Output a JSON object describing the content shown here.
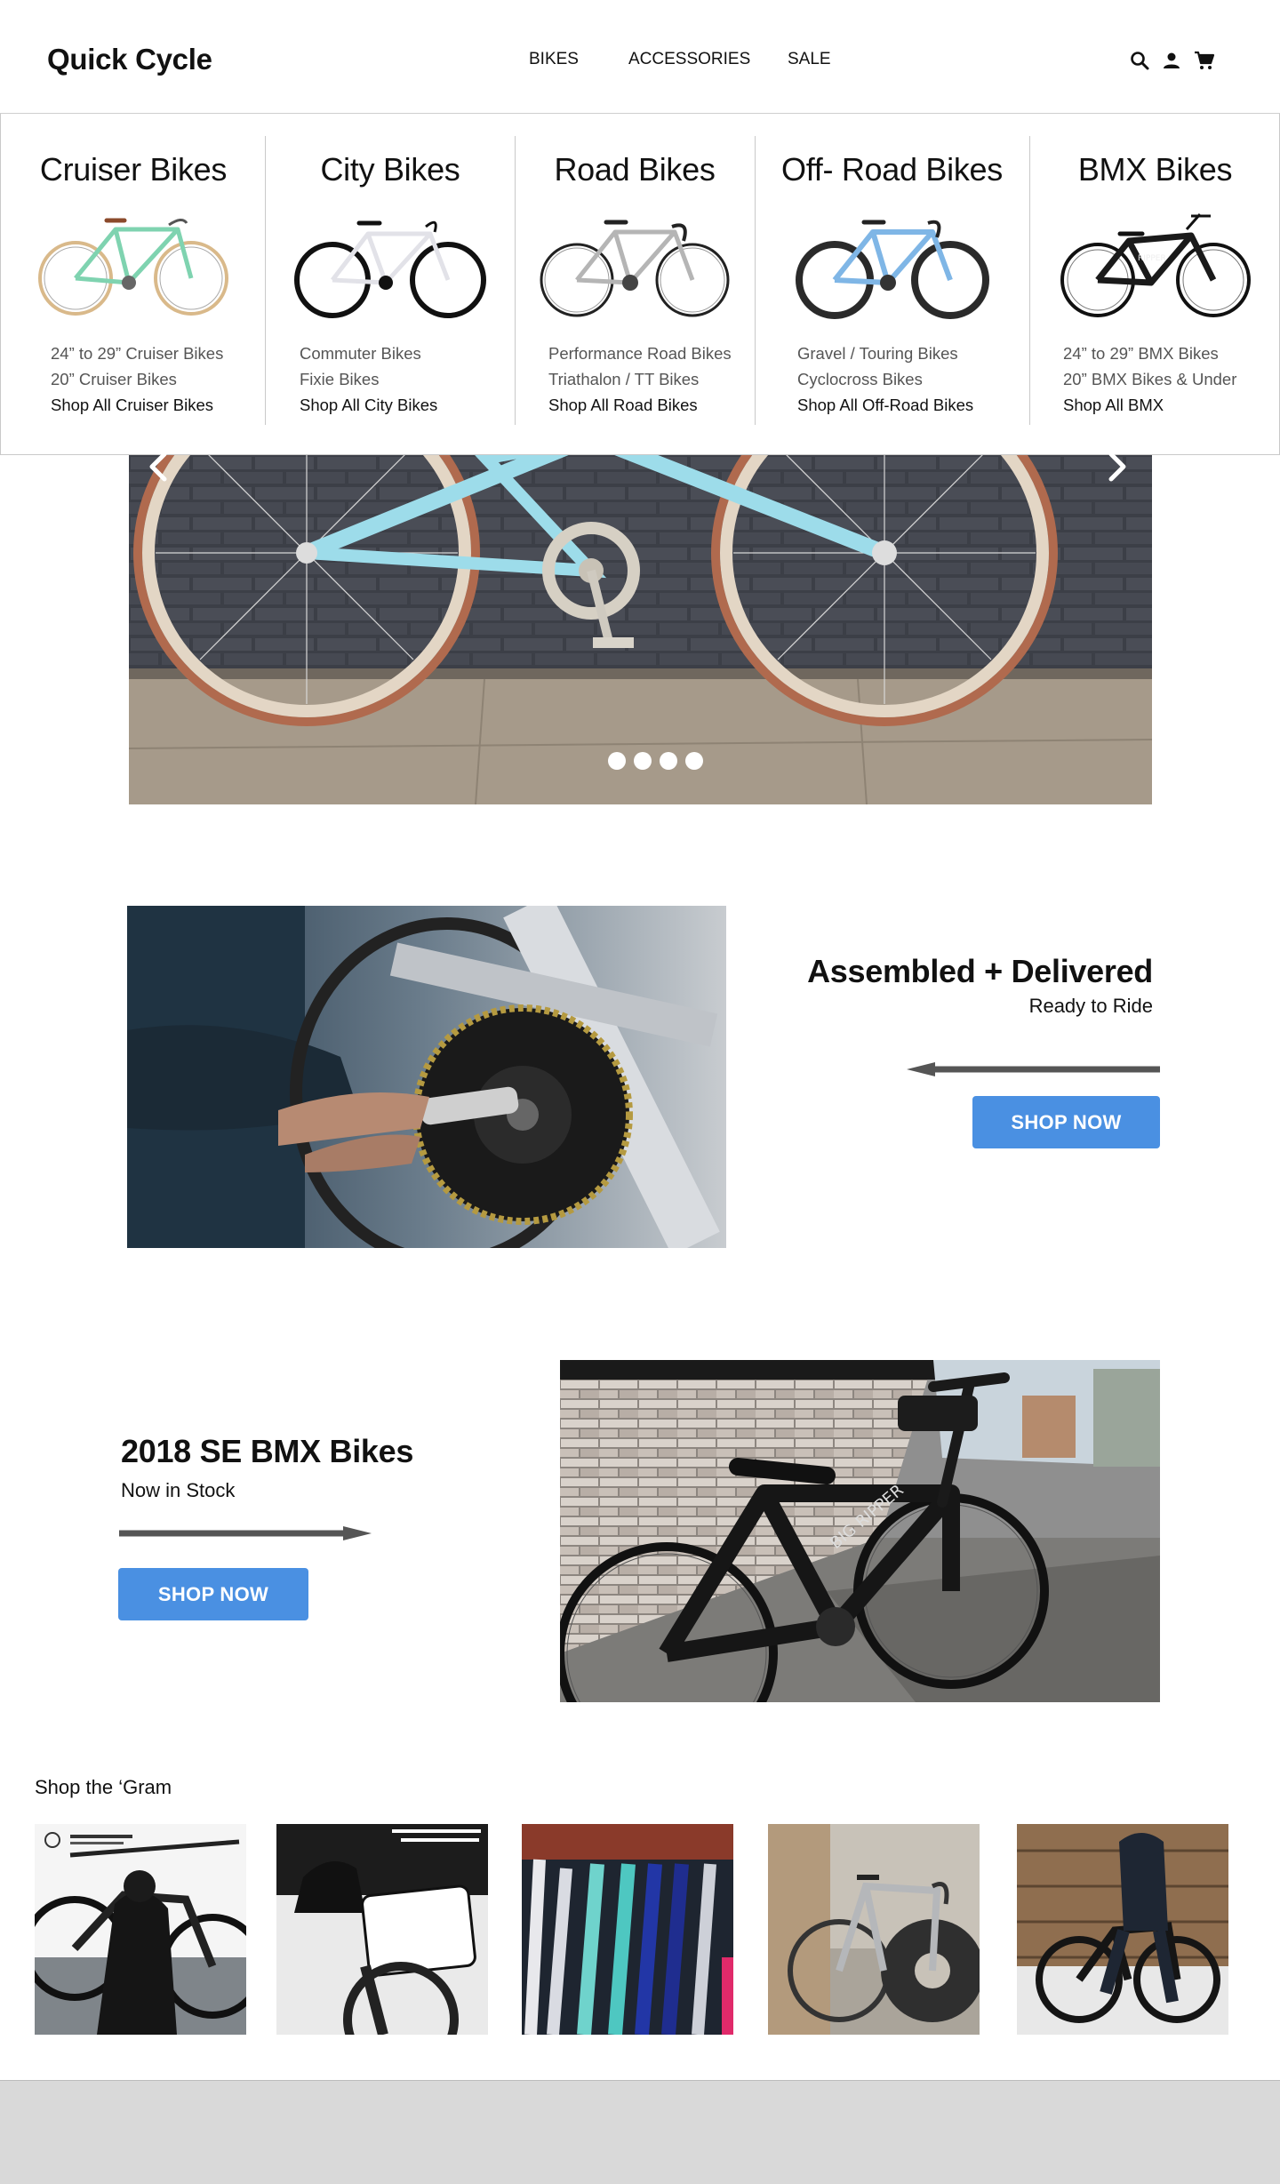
{
  "brand": {
    "logo": "Quick Cycle"
  },
  "nav": {
    "items": [
      "BIKES",
      "ACCESSORIES",
      "SALE"
    ],
    "icons": [
      "search-icon",
      "user-icon",
      "cart-icon"
    ]
  },
  "mega_menu": {
    "columns": [
      {
        "title": "Cruiser Bikes",
        "links": [
          "24” to 29” Cruiser Bikes",
          "20” Cruiser Bikes"
        ],
        "shop_all": "Shop All Cruiser Bikes",
        "bike_color": "#7fd3b0"
      },
      {
        "title": "City Bikes",
        "links": [
          "Commuter Bikes",
          "Fixie Bikes"
        ],
        "shop_all": "Shop All City Bikes",
        "bike_color": "#e6e6ea"
      },
      {
        "title": "Road Bikes",
        "links": [
          "Performance Road Bikes",
          "Triathalon / TT Bikes"
        ],
        "shop_all": "Shop All Road Bikes",
        "bike_color": "#b5b5b5"
      },
      {
        "title": "Off- Road Bikes",
        "links": [
          "Gravel / Touring Bikes",
          "Cyclocross Bikes"
        ],
        "shop_all": "Shop All Off-Road Bikes",
        "bike_color": "#7fb6e6"
      },
      {
        "title": "BMX Bikes",
        "links": [
          "24” to 29” BMX Bikes",
          "20” BMX Bikes & Under"
        ],
        "shop_all": "Shop All BMX",
        "bike_color": "#1a1a1a"
      }
    ]
  },
  "hero": {
    "slide_count": 4,
    "icons": [
      "chevron-left-icon",
      "chevron-right-icon"
    ]
  },
  "features": [
    {
      "title": "Assembled + Delivered",
      "subtitle": "Ready to Ride",
      "button": "SHOP NOW"
    },
    {
      "title": "2018 SE BMX Bikes",
      "subtitle": "Now in Stock",
      "button": "SHOP NOW"
    }
  ],
  "instagram": {
    "title": "Shop the ‘Gram",
    "post_count": 5
  },
  "colors": {
    "accent": "#4a90e2",
    "footer": "#d9d9d9",
    "arrow": "#555555"
  }
}
